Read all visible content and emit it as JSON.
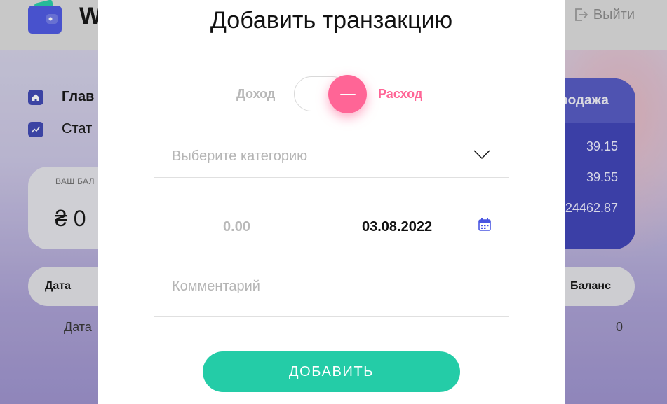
{
  "app": {
    "logo_text": "W",
    "logout_label": "Выйти"
  },
  "sidebar": {
    "items": [
      {
        "label": "Глав",
        "icon": "home-icon"
      },
      {
        "label": "Стат",
        "icon": "chart-icon"
      }
    ]
  },
  "balance": {
    "label": "ВАШ БАЛ",
    "value": "₴ 0"
  },
  "currency": {
    "header": "родажа",
    "values": [
      "39.15",
      "39.55",
      "24462.87"
    ]
  },
  "table": {
    "headers": {
      "date": "Дата",
      "balance": "Баланс"
    },
    "row": {
      "date": "Дата",
      "balance": "0"
    }
  },
  "modal": {
    "title": "Добавить транзакцию",
    "toggle": {
      "income_label": "Доход",
      "expense_label": "Расход",
      "selected": "expense"
    },
    "category": {
      "placeholder": "Выберите категорию"
    },
    "amount": {
      "placeholder": "0.00"
    },
    "date": {
      "value": "03.08.2022"
    },
    "comment": {
      "placeholder": "Комментарий"
    },
    "submit_label": "ДОБАВИТЬ"
  },
  "colors": {
    "accent_pink": "#ff6596",
    "accent_green": "#24cca7",
    "accent_blue": "#4a56e2"
  }
}
